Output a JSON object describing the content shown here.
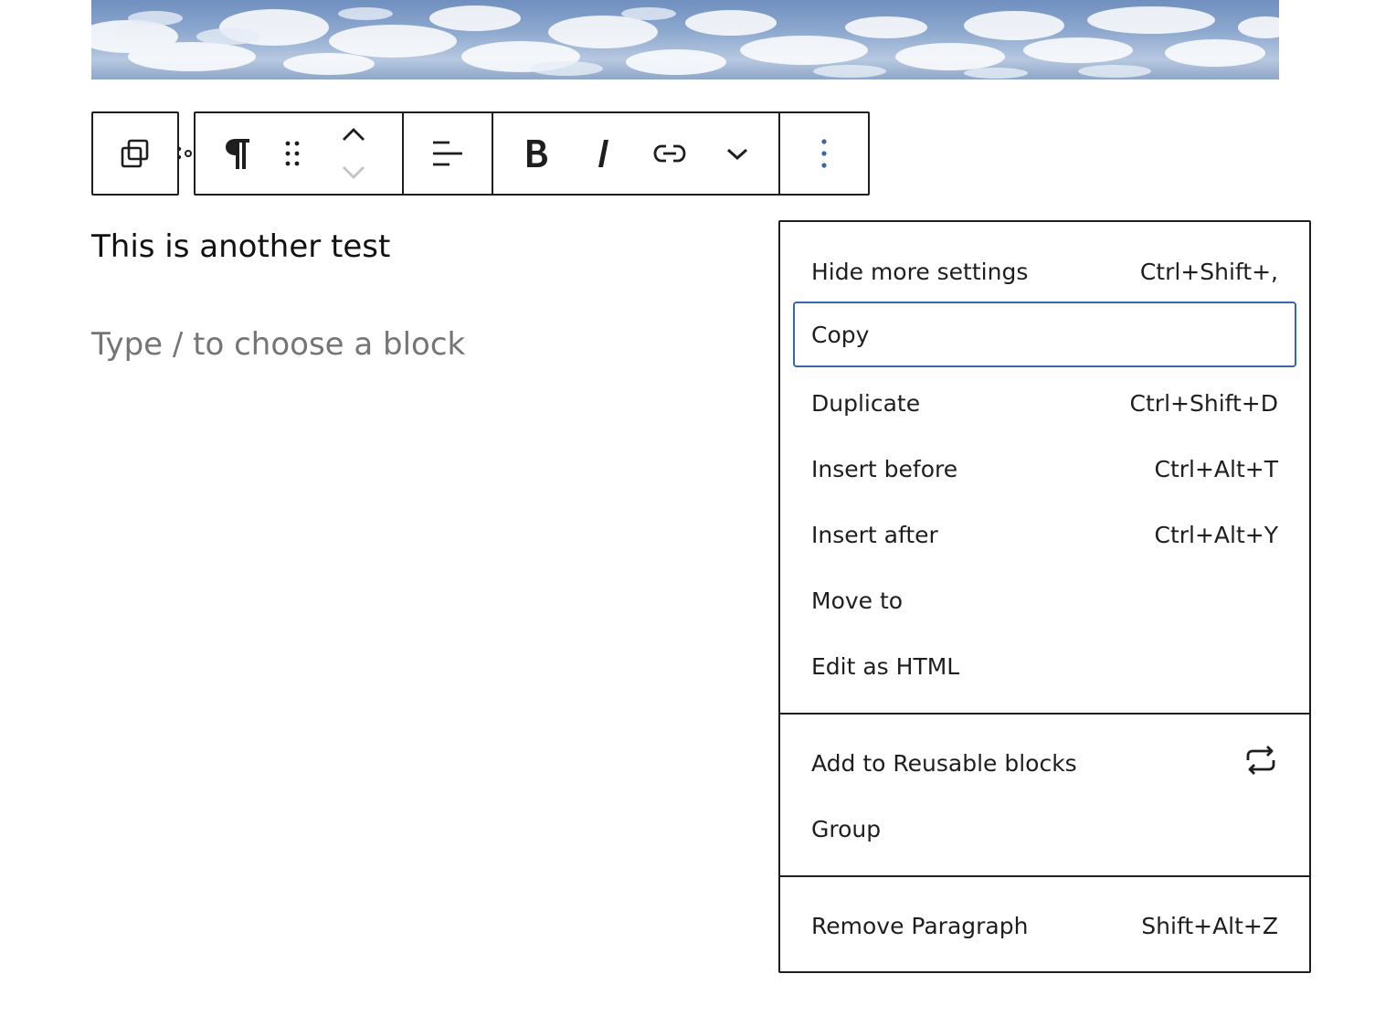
{
  "editor": {
    "paragraph_text": "This is another test",
    "placeholder_text": "Type / to choose a block"
  },
  "toolbar": {
    "transform_icon": "block-transform-icon",
    "paragraph_icon": "pilcrow-icon",
    "drag_icon": "drag-handle-icon",
    "move_up_icon": "chevron-up-icon",
    "move_down_icon": "chevron-down-icon",
    "align_icon": "align-left-icon",
    "bold_icon": "bold-icon",
    "italic_icon": "italic-icon",
    "link_icon": "link-icon",
    "more_rich_text_icon": "chevron-down-icon",
    "options_icon": "more-vertical-icon"
  },
  "menu": {
    "items": [
      {
        "label": "Hide more settings",
        "shortcut": "Ctrl+Shift+,"
      },
      {
        "label": "Copy",
        "shortcut": ""
      },
      {
        "label": "Duplicate",
        "shortcut": "Ctrl+Shift+D"
      },
      {
        "label": "Insert before",
        "shortcut": "Ctrl+Alt+T"
      },
      {
        "label": "Insert after",
        "shortcut": "Ctrl+Alt+Y"
      },
      {
        "label": "Move to",
        "shortcut": ""
      },
      {
        "label": "Edit as HTML",
        "shortcut": ""
      }
    ],
    "reusable": {
      "label": "Add to Reusable blocks",
      "icon": "reusable-block-icon"
    },
    "group": {
      "label": "Group"
    },
    "remove": {
      "label": "Remove Paragraph",
      "shortcut": "Shift+Alt+Z"
    }
  },
  "colors": {
    "focus_outline": "#3a65a6",
    "options_icon": "#3a65a6",
    "text": "#1e1e1e",
    "placeholder": "#757575"
  }
}
